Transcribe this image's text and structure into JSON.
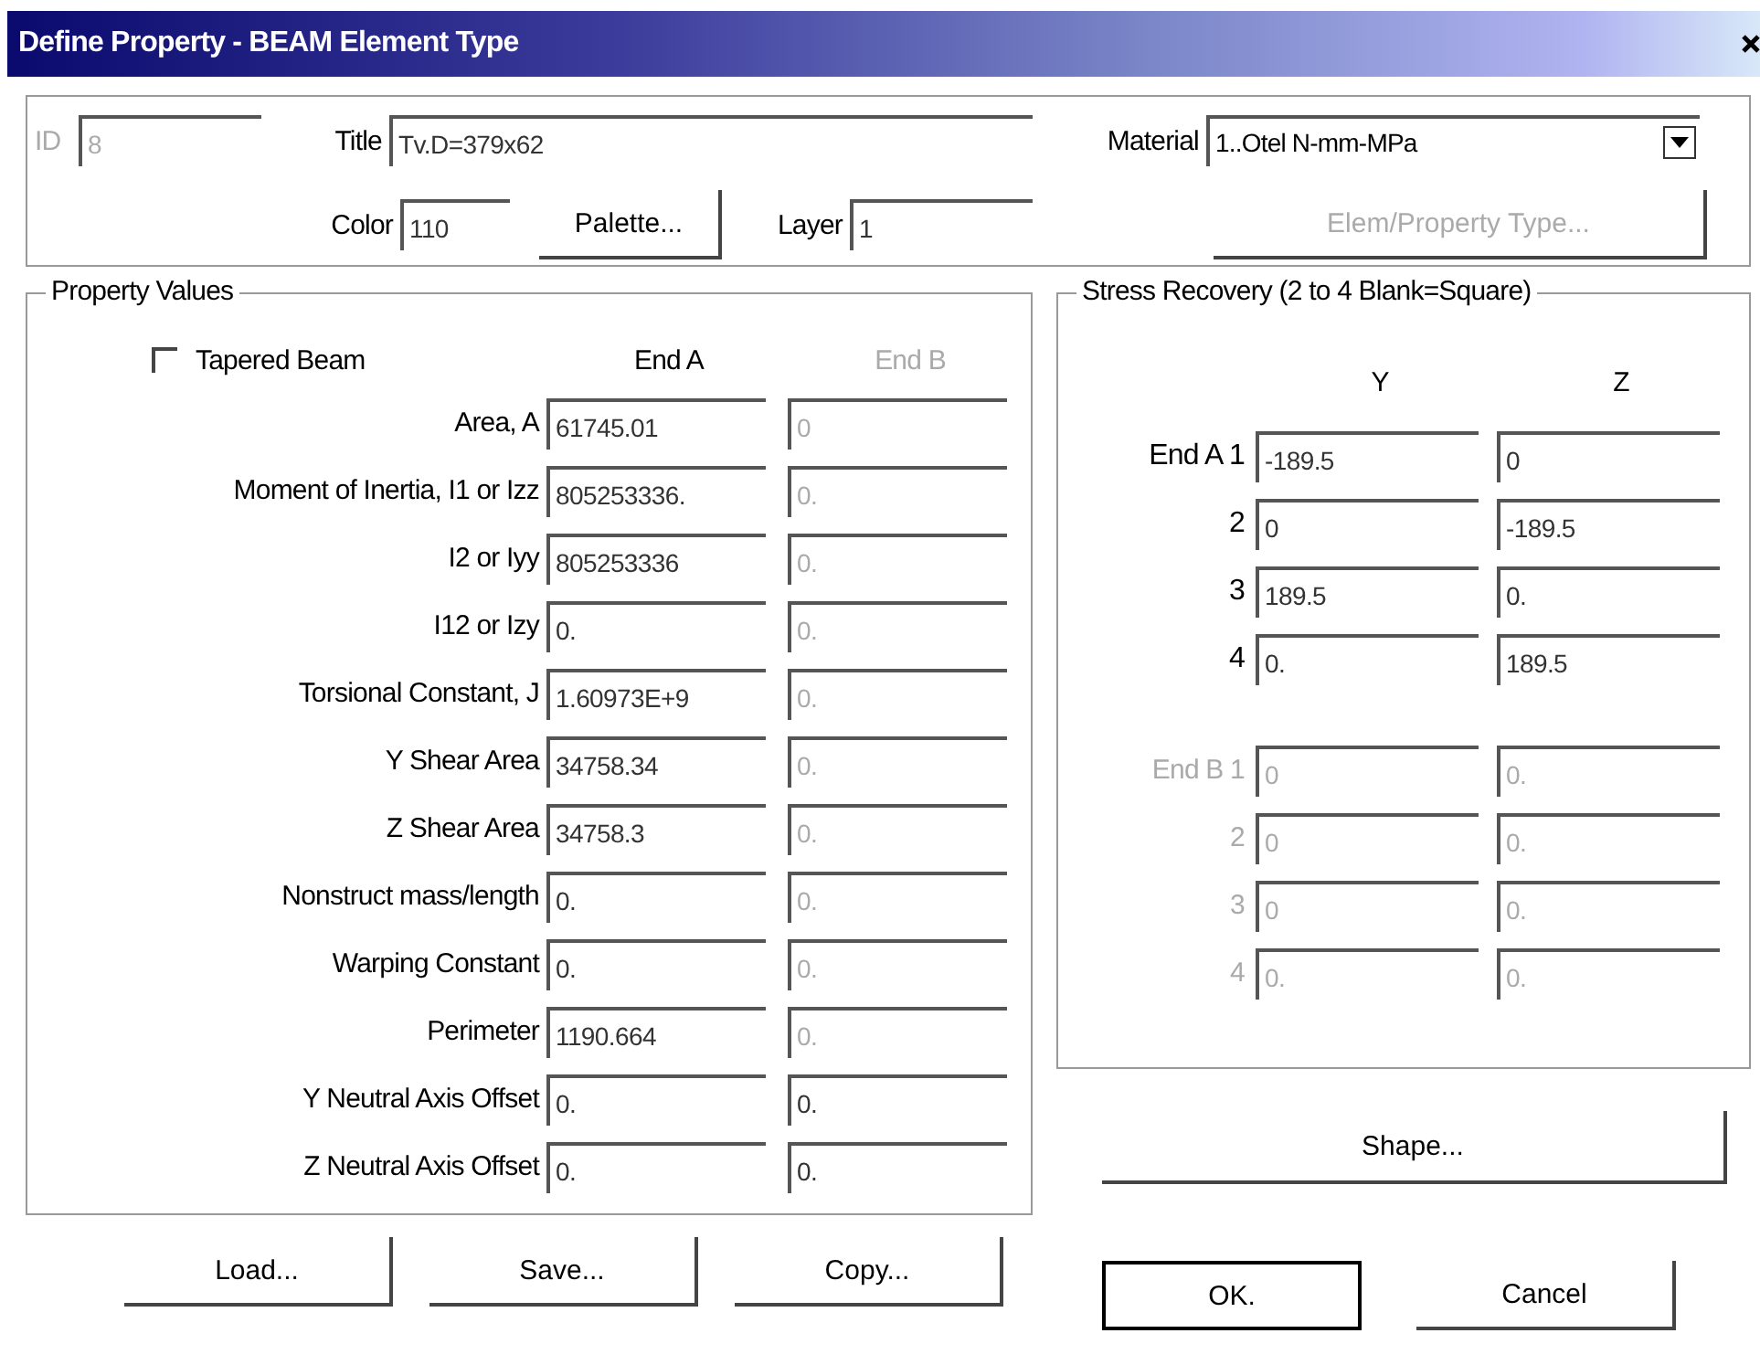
{
  "window": {
    "title": "Define Property - BEAM Element Type"
  },
  "header": {
    "id": {
      "label": "ID",
      "value": "8",
      "disabled": true
    },
    "title": {
      "label": "Title",
      "value": "Tv.D=379x62",
      "disabled": false
    },
    "material": {
      "label": "Material",
      "value": "1..Otel N-mm-MPa"
    },
    "color": {
      "label": "Color",
      "value": "110",
      "disabled": false
    },
    "palette_button": {
      "label": "Palette...",
      "disabled": false
    },
    "layer": {
      "label": "Layer",
      "value": "1",
      "disabled": false
    },
    "elem_type_button": {
      "label": "Elem/Property Type...",
      "disabled": true
    }
  },
  "property_values": {
    "title": "Property Values",
    "tapered": {
      "label": "Tapered Beam",
      "checked": false
    },
    "columns": [
      {
        "label": "End A",
        "disabled": false
      },
      {
        "label": "End B",
        "disabled": true
      }
    ],
    "rows": [
      {
        "label": "Area,  A",
        "cells": [
          {
            "value": "61745.01",
            "disabled": false
          },
          {
            "value": "0",
            "disabled": true
          }
        ]
      },
      {
        "label": "Moment of Inertia,  I1 or Izz",
        "cells": [
          {
            "value": "805253336.",
            "disabled": false
          },
          {
            "value": "0.",
            "disabled": true
          }
        ]
      },
      {
        "label": "I2 or Iyy",
        "cells": [
          {
            "value": "805253336",
            "disabled": false
          },
          {
            "value": "0.",
            "disabled": true
          }
        ]
      },
      {
        "label": "I12 or Izy",
        "cells": [
          {
            "value": "0.",
            "disabled": false
          },
          {
            "value": "0.",
            "disabled": true
          }
        ]
      },
      {
        "label": "Torsional Constant,  J",
        "cells": [
          {
            "value": "1.60973E+9",
            "disabled": false
          },
          {
            "value": "0.",
            "disabled": true
          }
        ]
      },
      {
        "label": "Y Shear Area",
        "cells": [
          {
            "value": "34758.34",
            "disabled": false
          },
          {
            "value": "0.",
            "disabled": true
          }
        ]
      },
      {
        "label": "Z Shear Area",
        "cells": [
          {
            "value": "34758.3",
            "disabled": false
          },
          {
            "value": "0.",
            "disabled": true
          }
        ]
      },
      {
        "label": "Nonstruct mass/length",
        "cells": [
          {
            "value": "0.",
            "disabled": false
          },
          {
            "value": "0.",
            "disabled": true
          }
        ]
      },
      {
        "label": "Warping Constant",
        "cells": [
          {
            "value": "0.",
            "disabled": false
          },
          {
            "value": "0.",
            "disabled": true
          }
        ]
      },
      {
        "label": "Perimeter",
        "cells": [
          {
            "value": "1190.664",
            "disabled": false
          },
          {
            "value": "0.",
            "disabled": true
          }
        ]
      },
      {
        "label": "Y Neutral Axis Offset",
        "cells": [
          {
            "value": "0.",
            "disabled": false
          },
          {
            "value": "0.",
            "disabled": false
          }
        ]
      },
      {
        "label": "Z Neutral Axis Offset",
        "cells": [
          {
            "value": "0.",
            "disabled": false
          },
          {
            "value": "0.",
            "disabled": false
          }
        ]
      }
    ]
  },
  "stress_recovery": {
    "title": "Stress Recovery (2 to 4 Blank=Square)",
    "columns": [
      "Y",
      "Z"
    ],
    "groups": [
      {
        "rows": [
          {
            "label": "End A 1",
            "disabled": false,
            "cells": [
              {
                "value": "-189.5",
                "disabled": false
              },
              {
                "value": "0",
                "disabled": false
              }
            ]
          },
          {
            "label": "2",
            "disabled": false,
            "cells": [
              {
                "value": "0",
                "disabled": false
              },
              {
                "value": "-189.5",
                "disabled": false
              }
            ]
          },
          {
            "label": "3",
            "disabled": false,
            "cells": [
              {
                "value": "189.5",
                "disabled": false
              },
              {
                "value": "0.",
                "disabled": false
              }
            ]
          },
          {
            "label": "4",
            "disabled": false,
            "cells": [
              {
                "value": "0.",
                "disabled": false
              },
              {
                "value": "189.5",
                "disabled": false
              }
            ]
          }
        ]
      },
      {
        "rows": [
          {
            "label": "End B 1",
            "disabled": true,
            "cells": [
              {
                "value": "0",
                "disabled": true
              },
              {
                "value": "0.",
                "disabled": true
              }
            ]
          },
          {
            "label": "2",
            "disabled": true,
            "cells": [
              {
                "value": "0",
                "disabled": true
              },
              {
                "value": "0.",
                "disabled": true
              }
            ]
          },
          {
            "label": "3",
            "disabled": true,
            "cells": [
              {
                "value": "0",
                "disabled": true
              },
              {
                "value": "0.",
                "disabled": true
              }
            ]
          },
          {
            "label": "4",
            "disabled": true,
            "cells": [
              {
                "value": "0.",
                "disabled": true
              },
              {
                "value": "0.",
                "disabled": true
              }
            ]
          }
        ]
      }
    ]
  },
  "shape_button": {
    "label": "Shape...",
    "disabled": false
  },
  "left_buttons": [
    {
      "label": "Load...",
      "default": false
    },
    {
      "label": "Save...",
      "default": false
    },
    {
      "label": "Copy...",
      "default": false
    }
  ],
  "right_buttons": [
    {
      "label": "OK.",
      "default": true
    },
    {
      "label": "Cancel",
      "default": false
    }
  ]
}
